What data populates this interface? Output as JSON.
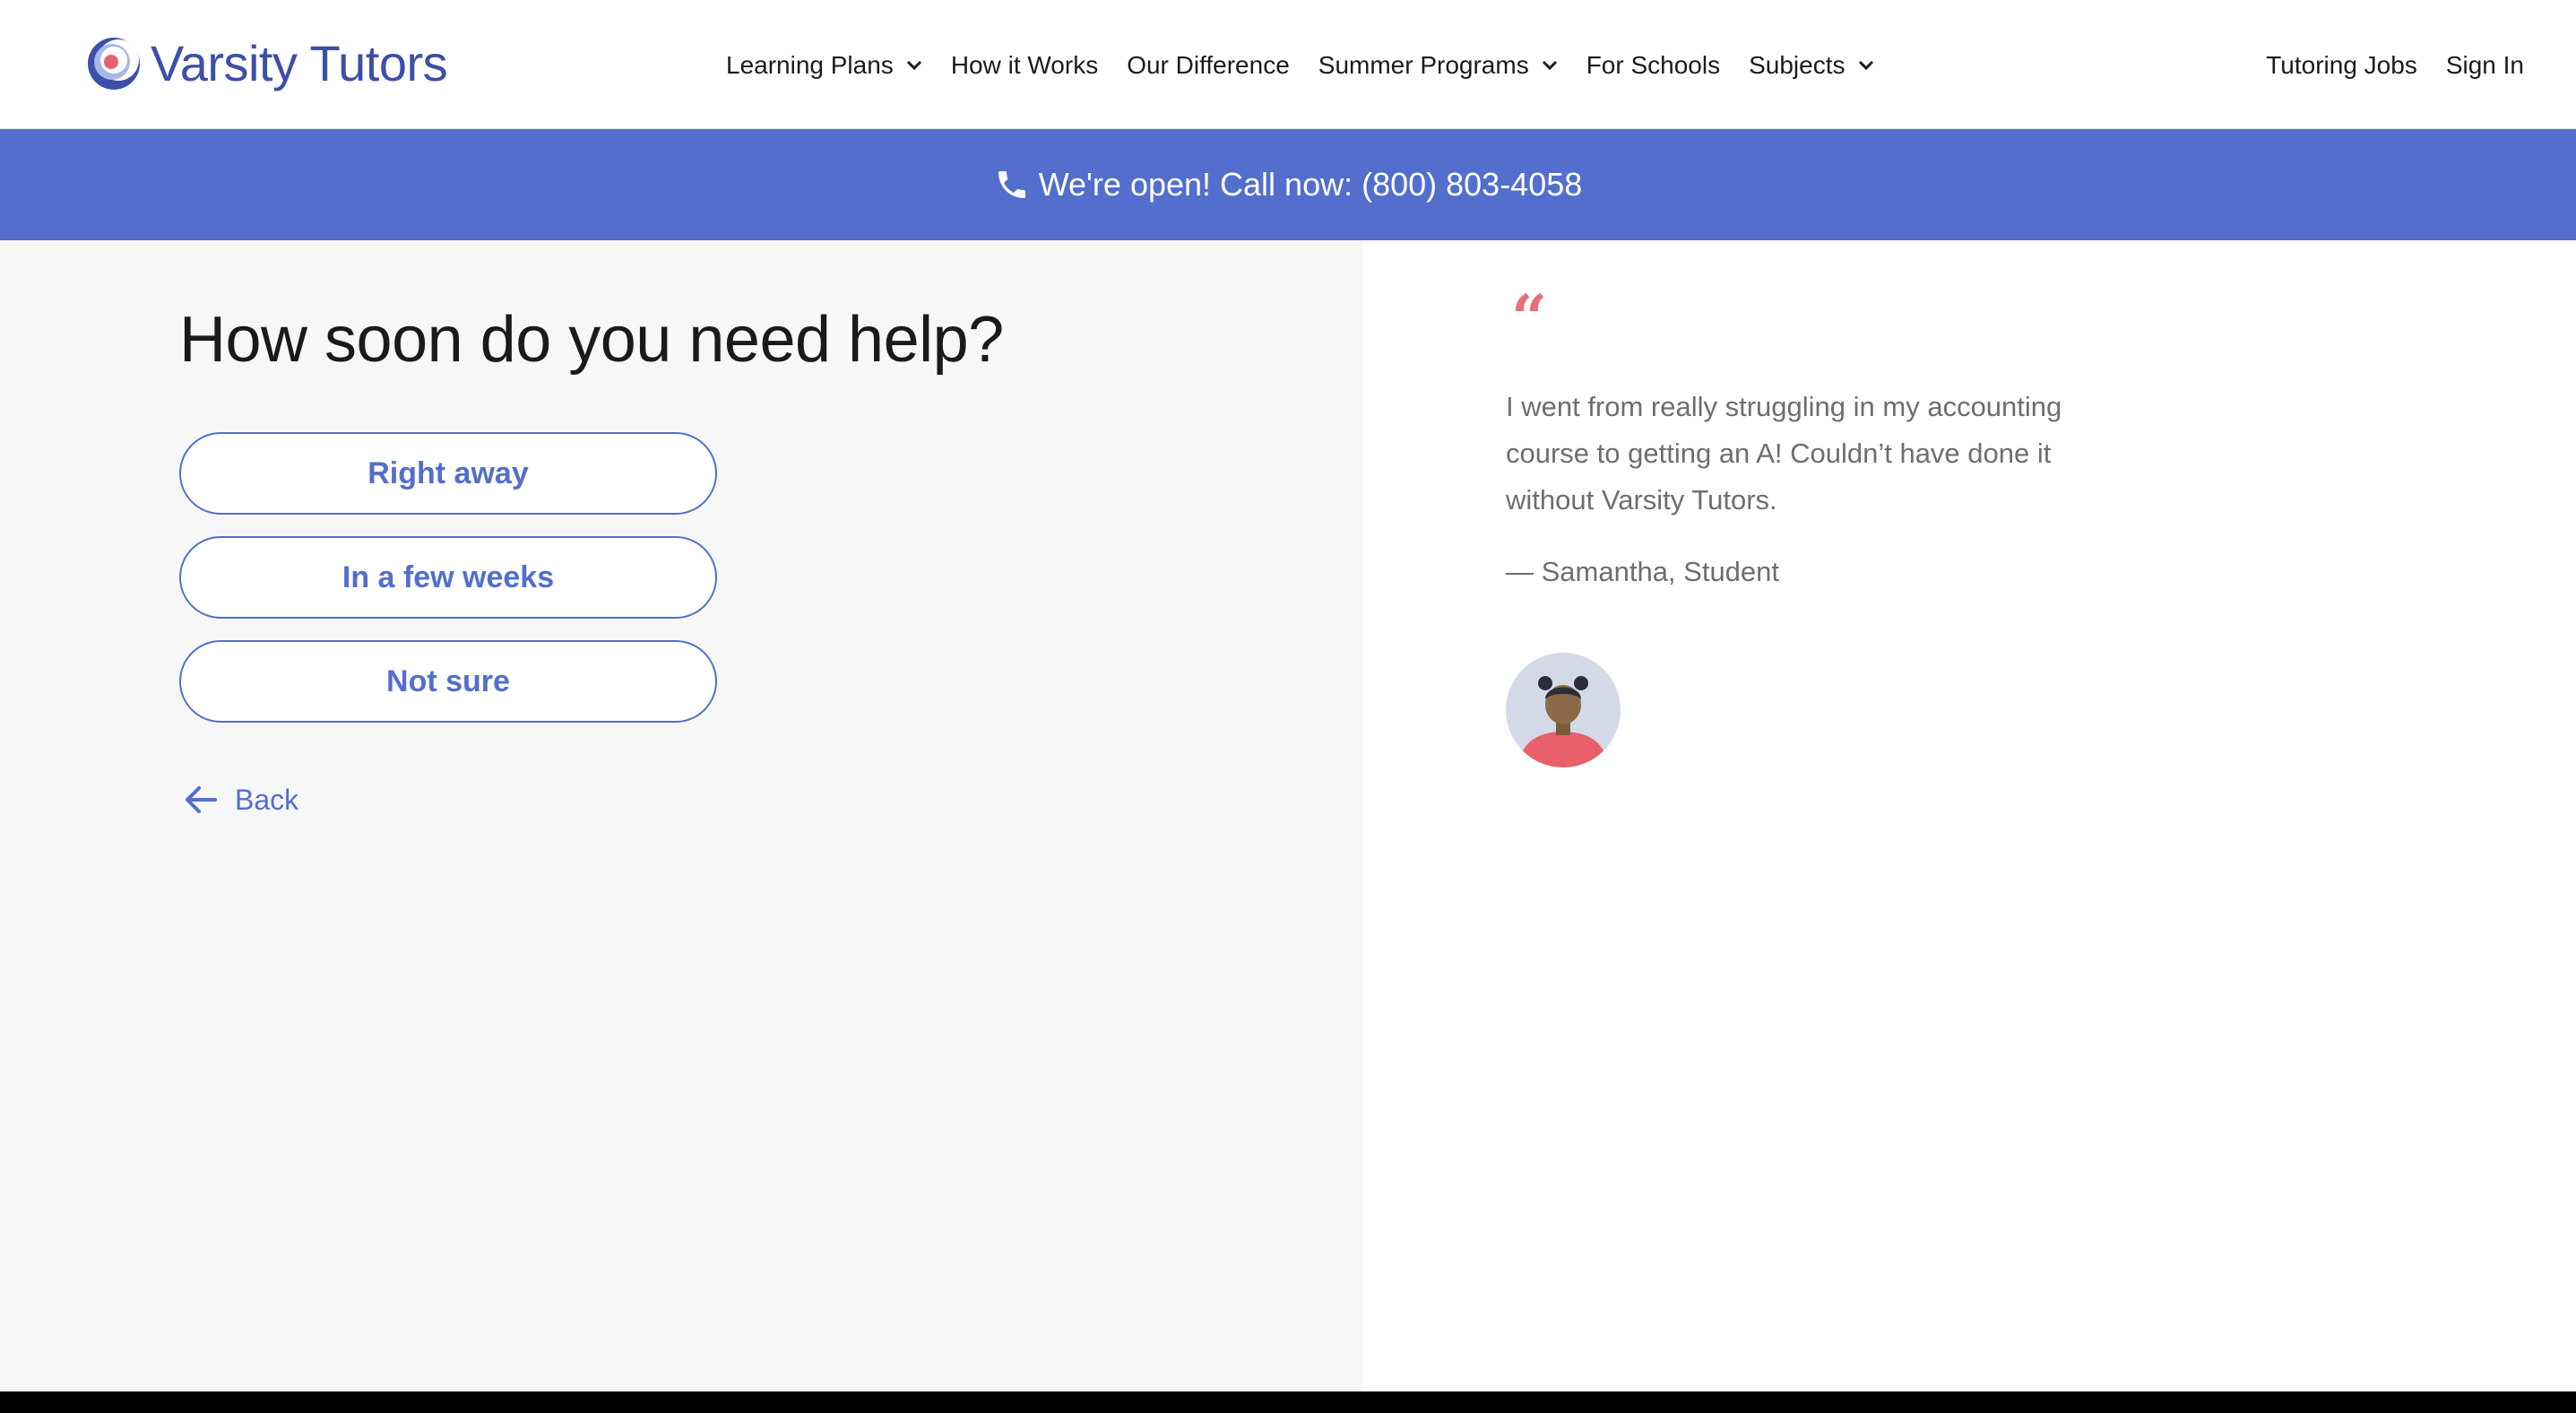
{
  "header": {
    "logo_text": "Varsity Tutors",
    "nav": [
      {
        "label": "Learning Plans",
        "has_dropdown": true
      },
      {
        "label": "How it Works",
        "has_dropdown": false
      },
      {
        "label": "Our Difference",
        "has_dropdown": false
      },
      {
        "label": "Summer Programs",
        "has_dropdown": true
      },
      {
        "label": "For Schools",
        "has_dropdown": false
      },
      {
        "label": "Subjects",
        "has_dropdown": true
      }
    ],
    "nav_right": [
      {
        "label": "Tutoring Jobs"
      },
      {
        "label": "Sign In"
      }
    ]
  },
  "banner": {
    "icon": "phone-icon",
    "text": "We're open! Call now: (800) 803-4058"
  },
  "form": {
    "question": "How soon do you need help?",
    "options": [
      "Right away",
      "In a few weeks",
      "Not sure"
    ],
    "back_label": "Back"
  },
  "testimonial": {
    "quote_mark": "“",
    "quote": "I went from really struggling in my accounting course to getting an A! Couldn’t have done it without Varsity Tutors.",
    "author": "— Samantha, Student"
  },
  "colors": {
    "brand_blue": "#536ecc",
    "logo_blue": "#3d4fa8",
    "quote_accent": "#e8707a",
    "left_panel_bg": "#f7f7f7"
  }
}
